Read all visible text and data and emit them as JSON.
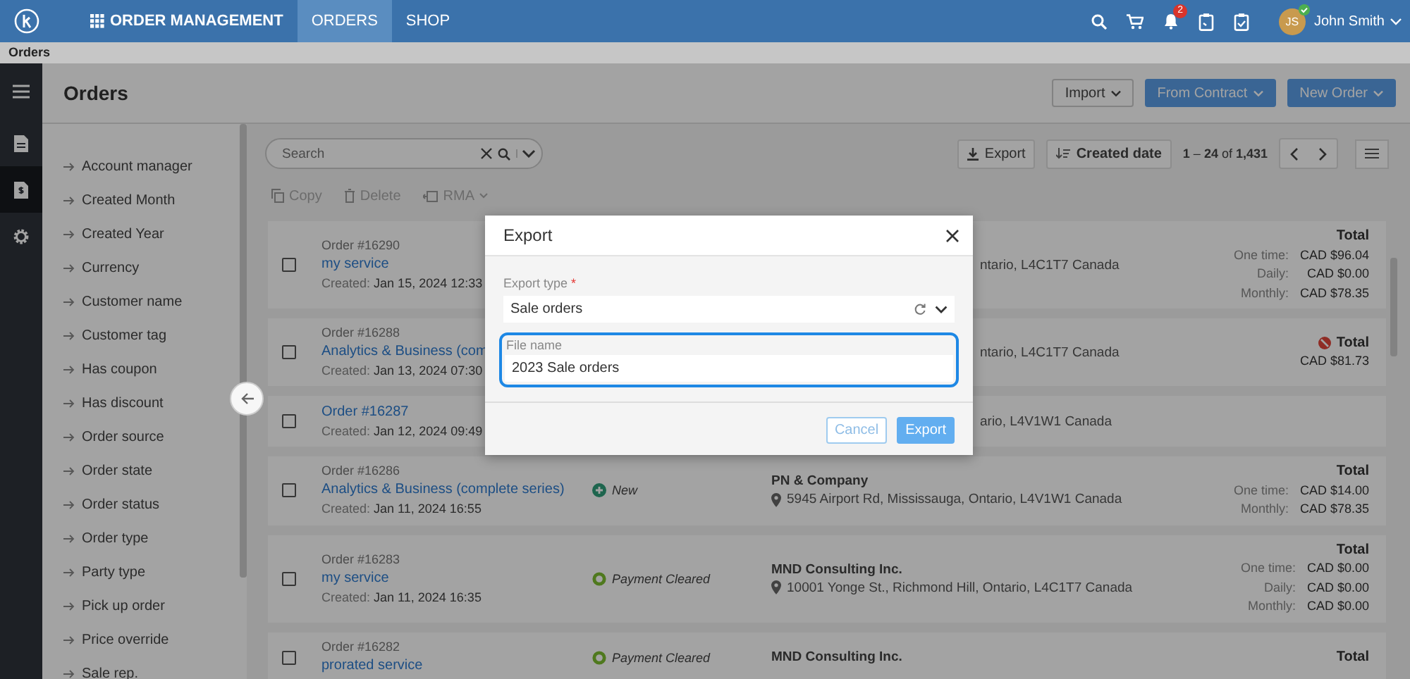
{
  "topbar": {
    "app_title": "ORDER MANAGEMENT",
    "nav": [
      {
        "label": "ORDERS",
        "selected": true
      },
      {
        "label": "SHOP",
        "selected": false
      }
    ],
    "notification_count": "2",
    "user": {
      "initials": "JS",
      "name": "John Smith"
    }
  },
  "breadcrumb": "Orders",
  "side_nav": [
    {
      "kind": "menu",
      "selected": false
    },
    {
      "kind": "document",
      "selected": false
    },
    {
      "kind": "invoice",
      "selected": true
    },
    {
      "kind": "settings",
      "selected": false
    }
  ],
  "page": {
    "title": "Orders",
    "buttons": [
      {
        "label": "Import",
        "kind": "outline"
      },
      {
        "label": "From Contract",
        "kind": "primary"
      },
      {
        "label": "New Order",
        "kind": "primary"
      }
    ]
  },
  "filters": [
    "Account manager",
    "Created Month",
    "Created Year",
    "Currency",
    "Customer name",
    "Customer tag",
    "Has coupon",
    "Has discount",
    "Order source",
    "Order state",
    "Order status",
    "Order type",
    "Party type",
    "Pick up order",
    "Price override",
    "Sale rep."
  ],
  "toolbar": {
    "search": {
      "placeholder": "Search"
    },
    "export": "Export",
    "sort": "Created date",
    "range": "**1** – **24** of **1,431**"
  },
  "actions": [
    {
      "label": "Copy",
      "kind": "copy",
      "disabled": true
    },
    {
      "label": "Delete",
      "kind": "delete",
      "disabled": true
    },
    {
      "label": "RMA",
      "kind": "rma",
      "disabled": true
    }
  ],
  "orders": [
    {
      "number": "Order #16290",
      "title": "my service",
      "created_label": "Created:",
      "created": "Jan 15, 2024 12:33",
      "checked": false,
      "customer": {
        "address": "ntario, L4C1T7 Canada"
      },
      "totals": {
        "heading": "Total",
        "alert": false,
        "lines": [
          {
            "label": "One time:",
            "amount": "CAD $96.04"
          },
          {
            "label": "Daily:",
            "amount": "CAD $0.00"
          },
          {
            "label": "Monthly:",
            "amount": "CAD $78.35"
          }
        ]
      }
    },
    {
      "number": "Order #16288",
      "title": "Analytics & Business (com",
      "created_label": "Created:",
      "created": "Jan 13, 2024 07:30",
      "checked": false,
      "customer": {
        "address": "ntario, L4C1T7 Canada"
      },
      "totals": {
        "heading": "Total",
        "alert": true,
        "lines": [
          {
            "amount": "CAD $81.73"
          }
        ]
      }
    },
    {
      "title": "Order #16287",
      "created_label": "Created:",
      "created": "Jan 12, 2024 09:49",
      "checked": false,
      "customer": {
        "address": "ario, L4V1W1 Canada"
      }
    },
    {
      "number": "Order #16286",
      "title": "Analytics & Business (complete series)",
      "created_label": "Created:",
      "created": "Jan 11, 2024 16:55",
      "checked": false,
      "status": {
        "label": "New",
        "kind": "new"
      },
      "customer": {
        "company": "PN & Company",
        "address": "5945 Airport Rd, Mississauga, Ontario, L4V1W1 Canada"
      },
      "totals": {
        "heading": "Total",
        "alert": false,
        "lines": [
          {
            "label": "One time:",
            "amount": "CAD $14.00"
          },
          {
            "label": "Monthly:",
            "amount": "CAD $78.35"
          }
        ]
      }
    },
    {
      "number": "Order #16283",
      "title": "my service",
      "created_label": "Created:",
      "created": "Jan 11, 2024 16:35",
      "checked": false,
      "status": {
        "label": "Payment Cleared",
        "kind": "cleared"
      },
      "customer": {
        "company": "MND Consulting Inc.",
        "address": "10001 Yonge St., Richmond Hill, Ontario, L4C1T7 Canada"
      },
      "totals": {
        "heading": "Total",
        "alert": false,
        "lines": [
          {
            "label": "One time:",
            "amount": "CAD $0.00"
          },
          {
            "label": "Daily:",
            "amount": "CAD $0.00"
          },
          {
            "label": "Monthly:",
            "amount": "CAD $0.00"
          }
        ]
      }
    },
    {
      "number": "Order #16282",
      "title": "prorated service",
      "checked": false,
      "status": {
        "label": "Payment Cleared",
        "kind": "cleared"
      },
      "customer": {
        "company": "MND Consulting Inc."
      },
      "totals": {
        "heading": "Total",
        "alert": false
      }
    }
  ],
  "modal": {
    "title": "Export",
    "export_type": {
      "label": "Export type",
      "required_mark": "*",
      "value": "Sale orders"
    },
    "file_name": {
      "label": "File name",
      "value": "2023 Sale orders",
      "focused": true
    },
    "buttons": [
      {
        "label": "Cancel",
        "kind": "outline"
      },
      {
        "label": "Export",
        "kind": "primary"
      }
    ]
  }
}
